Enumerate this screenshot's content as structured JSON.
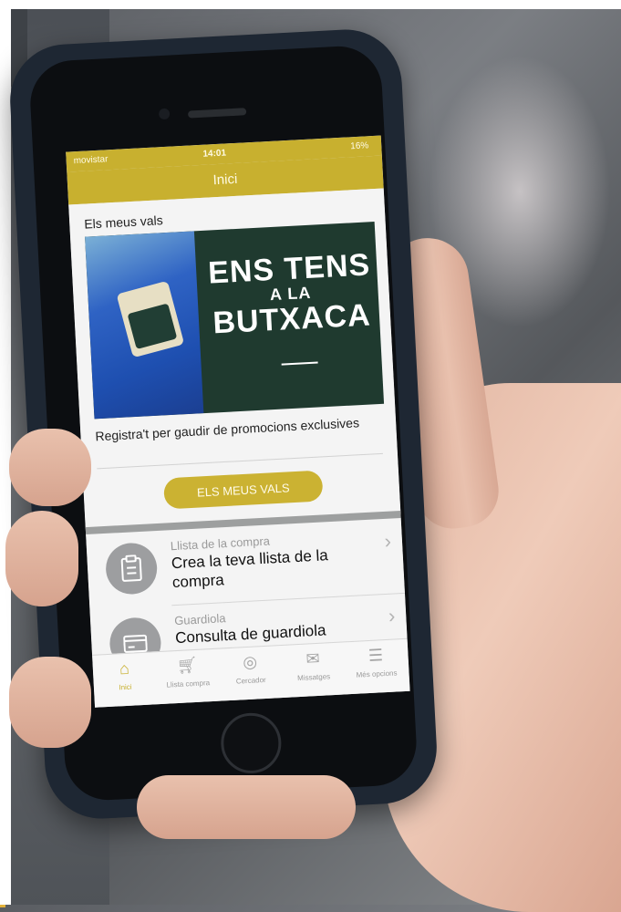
{
  "status_bar": {
    "carrier": "movistar",
    "time": "14:01",
    "battery": "16%"
  },
  "app": {
    "title": "Inici"
  },
  "vals": {
    "section_title": "Els meus vals",
    "banner_line1": "ENS TENS",
    "banner_line2": "A LA",
    "banner_line3": "BUTXACA",
    "promo_text": "Registra't per gaudir de promocions exclusives",
    "button_label": "ELS MEUS VALS"
  },
  "list": [
    {
      "small": "Llista de la compra",
      "big": "Crea la teva llista de la compra",
      "icon": "clipboard-icon"
    },
    {
      "small": "Guardiola",
      "big": "Consulta de guardiola",
      "icon": "card-icon"
    }
  ],
  "tabs": [
    {
      "label": "Inici",
      "icon": "home-icon",
      "active": true
    },
    {
      "label": "Llista compra",
      "icon": "cart-icon",
      "active": false
    },
    {
      "label": "Cercador",
      "icon": "compass-icon",
      "active": false
    },
    {
      "label": "Missatges",
      "icon": "mail-icon",
      "active": false
    },
    {
      "label": "Més opcions",
      "icon": "menu-icon",
      "active": false
    }
  ],
  "colors": {
    "brand": "#c8b02f",
    "banner_bg": "#1f3a2f",
    "phone_case": "#1e2733"
  }
}
